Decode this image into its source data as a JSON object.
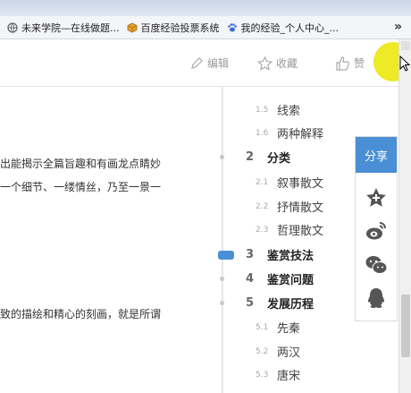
{
  "bookmarks": {
    "items": [
      {
        "label": "未来学院—在线做题...",
        "icon": "globe-icon"
      },
      {
        "label": "百度经验投票系统",
        "icon": "cube-icon"
      },
      {
        "label": "我的经验_个人中心_...",
        "icon": "paw-icon"
      }
    ],
    "more": "»"
  },
  "toolbar": {
    "edit_label": "编辑",
    "favorite_label": "收藏",
    "like_label": "赞"
  },
  "article": {
    "lines": [
      "出能揭示全篇旨趣和有画龙点睛妙",
      "一个细节、一缕情丝，乃至一景一",
      "致的描绘和精心的刻画，就是所谓"
    ]
  },
  "outline": {
    "items": [
      {
        "num": "1.5",
        "label": "线索",
        "level": "sub"
      },
      {
        "num": "1.6",
        "label": "两种解释",
        "level": "sub"
      },
      {
        "num": "2",
        "label": "分类",
        "level": "main"
      },
      {
        "num": "2.1",
        "label": "叙事散文",
        "level": "sub"
      },
      {
        "num": "2.2",
        "label": "抒情散文",
        "level": "sub"
      },
      {
        "num": "2.3",
        "label": "哲理散文",
        "level": "sub"
      },
      {
        "num": "3",
        "label": "鉴赏技法",
        "level": "main"
      },
      {
        "num": "4",
        "label": "鉴赏问题",
        "level": "main"
      },
      {
        "num": "5",
        "label": "发展历程",
        "level": "main"
      },
      {
        "num": "5.1",
        "label": "先秦",
        "level": "sub"
      },
      {
        "num": "5.2",
        "label": "两汉",
        "level": "sub"
      },
      {
        "num": "5.3",
        "label": "唐宋",
        "level": "sub"
      }
    ],
    "active": "3"
  },
  "share": {
    "title": "分享",
    "icons": [
      "star-icon",
      "weibo-icon",
      "wechat-icon",
      "qq-icon"
    ]
  },
  "colors": {
    "accent": "#4a8fd6",
    "highlight": "#ebe814"
  }
}
